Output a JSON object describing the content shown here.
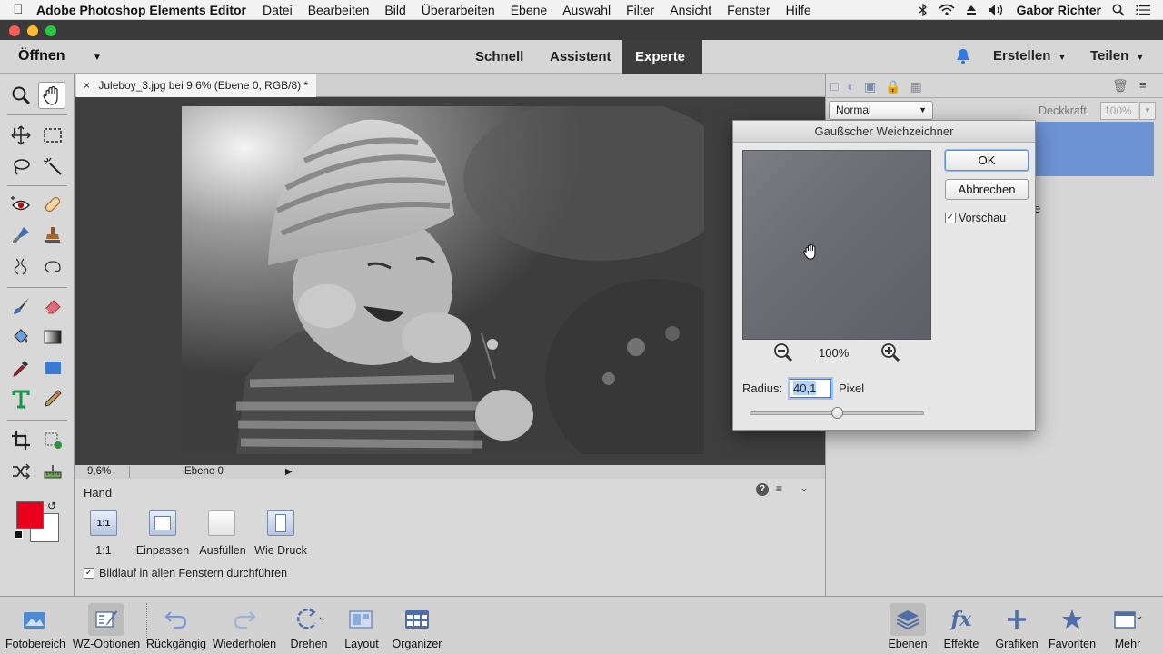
{
  "menubar": {
    "app_name": "Adobe Photoshop Elements Editor",
    "items": [
      "Datei",
      "Bearbeiten",
      "Bild",
      "Überarbeiten",
      "Ebene",
      "Auswahl",
      "Filter",
      "Ansicht",
      "Fenster",
      "Hilfe"
    ],
    "user": "Gabor Richter"
  },
  "modebar": {
    "open_label": "Öffnen",
    "tabs": [
      "Schnell",
      "Assistent",
      "Experte"
    ],
    "active_tab": "Experte",
    "create_label": "Erstellen",
    "share_label": "Teilen"
  },
  "document": {
    "tab_title": "Juleboy_3.jpg bei 9,6% (Ebene 0, RGB/8) *",
    "close_glyph": "×",
    "zoom": "9,6%",
    "layer_info": "Ebene 0"
  },
  "tool_options": {
    "tool_name": "Hand",
    "buttons": [
      "1:1",
      "Einpassen",
      "Ausfüllen",
      "Wie Druck"
    ],
    "ratio_icon_text": "1:1",
    "scroll_all_label": "Bildlauf in allen Fenstern durchführen",
    "scroll_all_checked": true
  },
  "layers_panel": {
    "blend_mode": "Normal",
    "opacity_label": "Deckkraft:",
    "opacity_value": "100%",
    "partial_text": "e"
  },
  "dialog": {
    "title": "Gaußscher Weichzeichner",
    "ok_label": "OK",
    "cancel_label": "Abbrechen",
    "preview_label": "Vorschau",
    "preview_checked": true,
    "zoom_level": "100%",
    "radius_label": "Radius:",
    "radius_value": "40,1",
    "radius_unit": "Pixel",
    "radius_slider_fraction": 0.5
  },
  "bottombar": {
    "left_items": [
      "Fotobereich",
      "WZ-Optionen",
      "Rückgängig",
      "Wiederholen",
      "Drehen",
      "Layout",
      "Organizer"
    ],
    "right_items": [
      "Ebenen",
      "Effekte",
      "Grafiken",
      "Favoriten",
      "Mehr"
    ]
  },
  "colors": {
    "foreground": "#e8001c",
    "background": "#ffffff",
    "accent": "#3b7ad8"
  }
}
